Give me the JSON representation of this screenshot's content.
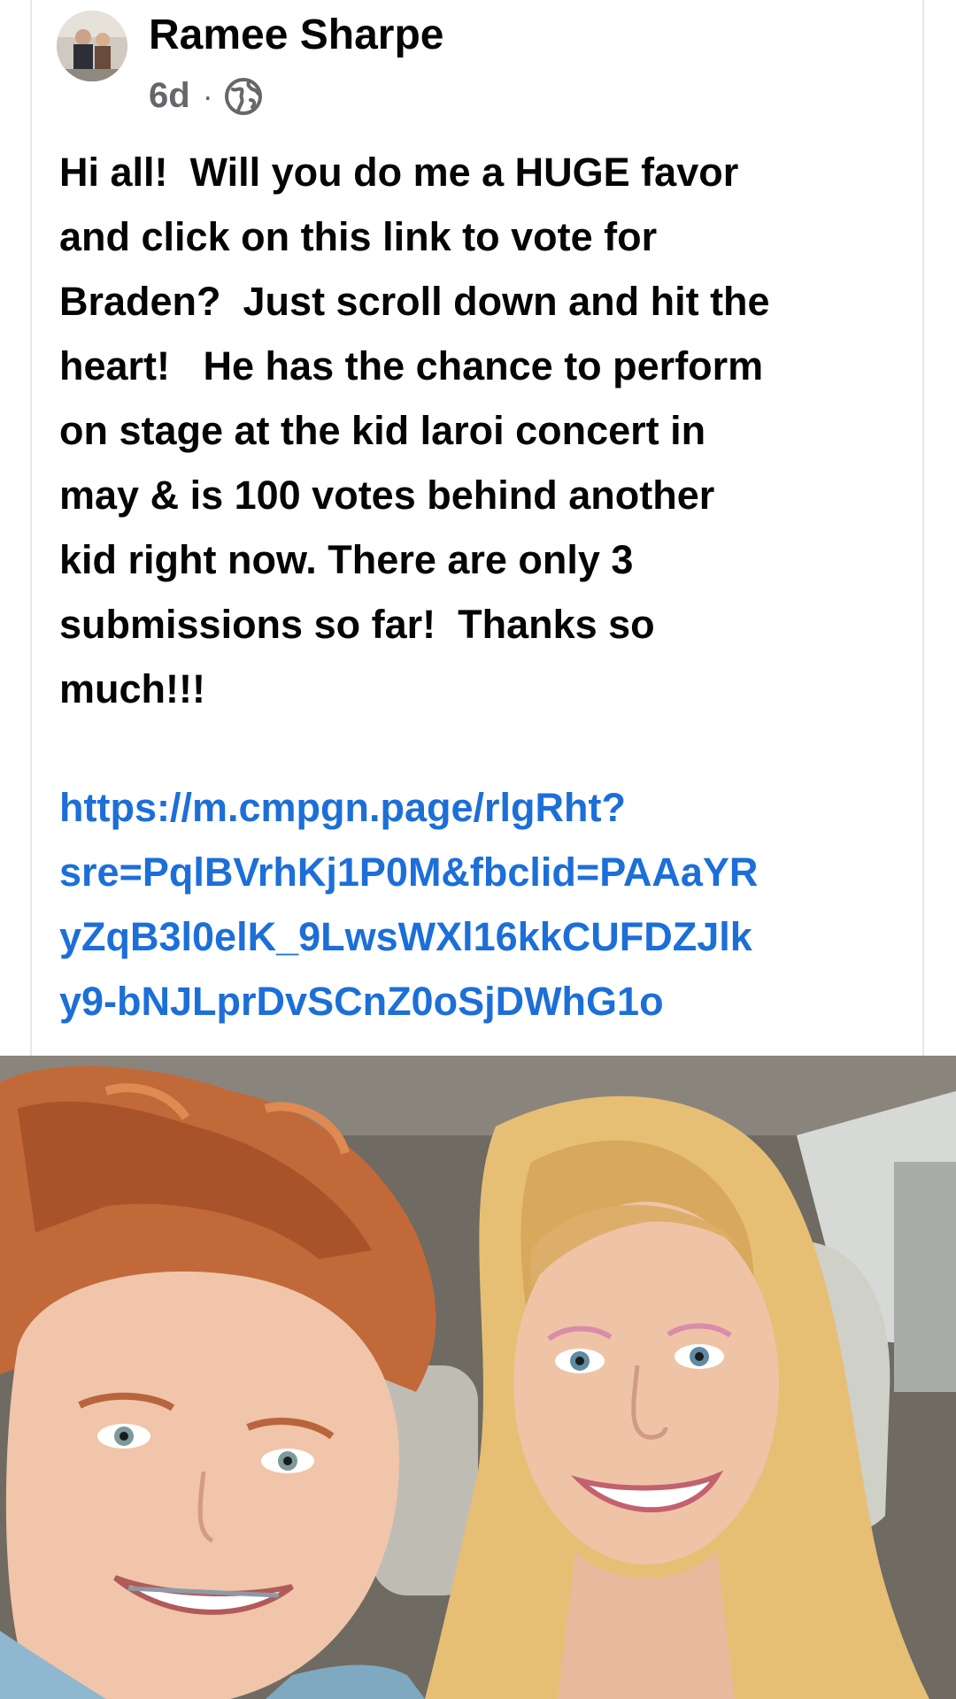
{
  "post": {
    "author": "Ramee Sharpe",
    "time": "6d",
    "separator": "·",
    "audience_icon": "globe-icon",
    "text_lines": [
      "Hi all!  Will you do me a HUGE favor",
      "and click on this link to vote for",
      "Braden?  Just scroll down and hit the",
      "heart!   He has the chance to perform",
      "on stage at the kid laroi concert in",
      "may & is 100 votes behind another",
      "kid right now. There are only 3",
      "submissions so far!  Thanks so",
      "much!!!"
    ],
    "link_lines": [
      "https://m.cmpgn.page/rlgRht?",
      "sre=PqlBVrhKj1P0M&fbclid=PAAaYR",
      "yZqB3l0elK_9LwsWXl16kkCUFDZJlk",
      "y9-bNJLprDvSCnZ0oSjDWhG1o"
    ],
    "link_color": "#1c6fd8"
  },
  "photo": {
    "icon": "photo-selfie-image"
  }
}
